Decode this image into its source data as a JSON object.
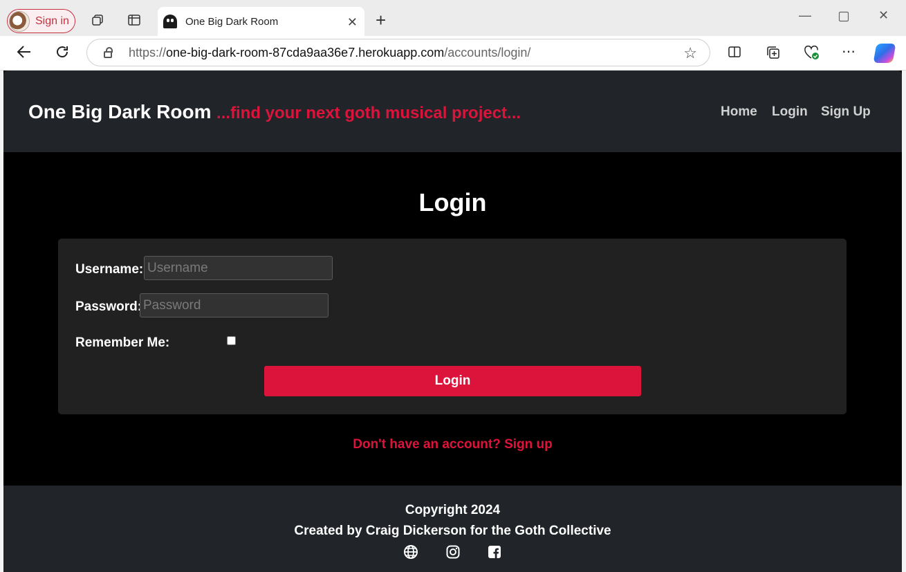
{
  "browser": {
    "profile_label": "Sign in",
    "tab_title": "One Big Dark Room",
    "url_scheme": "https://",
    "url_host": "one-big-dark-room-87cda9aa36e7.herokuapp.com",
    "url_path": "/accounts/login/"
  },
  "header": {
    "brand": "One Big Dark Room",
    "tagline": "...find your next goth musical project...",
    "nav": [
      "Home",
      "Login",
      "Sign Up"
    ]
  },
  "login": {
    "heading": "Login",
    "username_label": "Username:",
    "username_placeholder": "Username",
    "password_label": "Password:",
    "password_placeholder": "Password",
    "remember_label": "Remember Me:",
    "submit_label": "Login",
    "signup_prompt": "Don't have an account? Sign up"
  },
  "footer": {
    "copyright": "Copyright 2024",
    "credits": "Created by Craig Dickerson for the Goth Collective",
    "social_icons": [
      "globe-icon",
      "instagram-icon",
      "facebook-icon"
    ]
  },
  "colors": {
    "accent": "#dc143c",
    "header_bg": "#212529",
    "card_bg": "#212121",
    "page_bg": "#000000"
  }
}
